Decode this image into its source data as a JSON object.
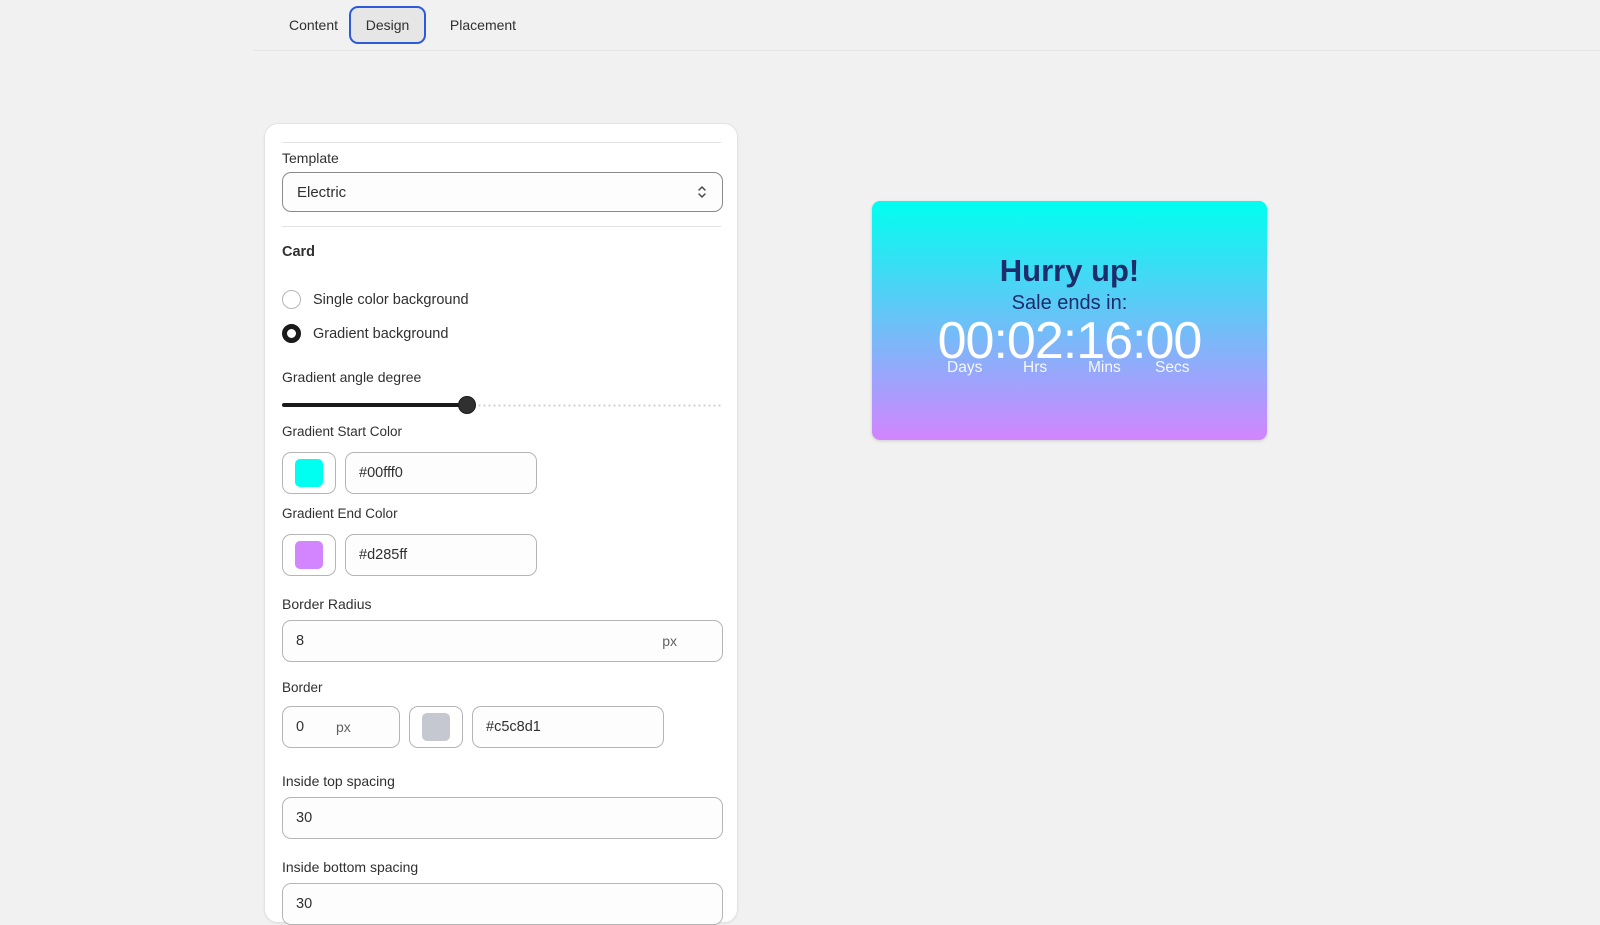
{
  "tabs": [
    {
      "label": "Content",
      "active": false
    },
    {
      "label": "Design",
      "active": true
    },
    {
      "label": "Placement",
      "active": false
    }
  ],
  "panel": {
    "template": {
      "label": "Template",
      "value": "Electric"
    },
    "card_heading": "Card",
    "background_options": [
      {
        "label": "Single color background",
        "selected": false
      },
      {
        "label": "Gradient background",
        "selected": true
      }
    ],
    "gradient_angle": {
      "label": "Gradient angle degree",
      "fraction": 0.42
    },
    "gradient_start": {
      "label": "Gradient Start Color",
      "value": "#00fff0",
      "color": "#00fff0"
    },
    "gradient_end": {
      "label": "Gradient End Color",
      "value": "#d285ff",
      "color": "#d285ff"
    },
    "border_radius": {
      "label": "Border Radius",
      "value": "8",
      "suffix": "px"
    },
    "border": {
      "label": "Border",
      "width": "0",
      "suffix": "px",
      "color_value": "#c5c8d1",
      "color": "#c5c8d1"
    },
    "inside_top": {
      "label": "Inside top spacing",
      "value": "30"
    },
    "inside_bottom": {
      "label": "Inside bottom spacing",
      "value": "30"
    }
  },
  "preview": {
    "title": "Hurry up!",
    "subtitle": "Sale ends in:",
    "clock": "00:02:16:00",
    "units": [
      "Days",
      "Hrs",
      "Mins",
      "Secs"
    ],
    "title_color": "#1d2c6b"
  }
}
